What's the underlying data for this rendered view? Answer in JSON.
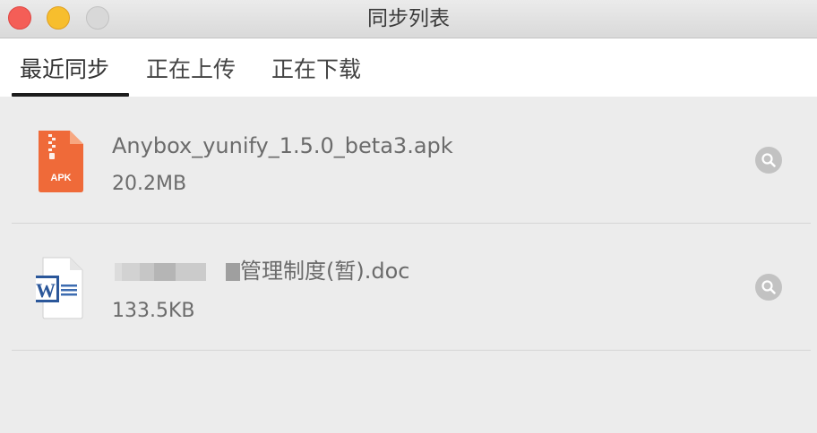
{
  "window": {
    "title": "同步列表"
  },
  "tabs": [
    {
      "label": "最近同步"
    },
    {
      "label": "正在上传"
    },
    {
      "label": "正在下载"
    }
  ],
  "files": [
    {
      "name": "Anybox_yunify_1.5.0_beta3.apk",
      "size": "20.2MB",
      "icon": "apk-file-icon",
      "badge": "APK",
      "color": "#ef6a39"
    },
    {
      "name_visible": "管理制度(暂).doc",
      "size": "133.5KB",
      "icon": "word-file-icon",
      "badge": "W",
      "color": "#2b579a"
    }
  ],
  "actions": {
    "icon": "search-icon"
  }
}
